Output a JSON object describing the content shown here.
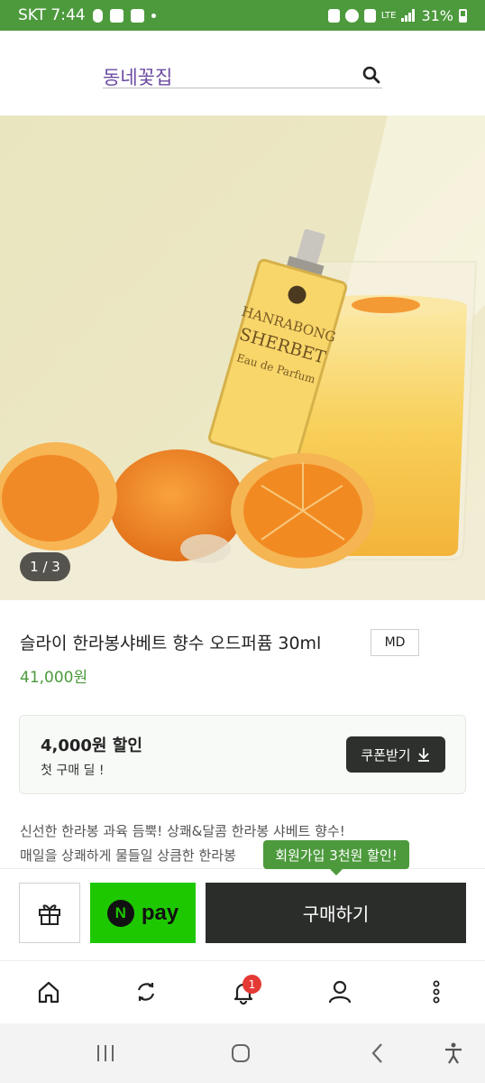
{
  "status_bar": {
    "carrier_time": "SKT 7:44",
    "network": "LTE",
    "battery": "31%"
  },
  "header": {
    "search_text": "동네꽃집",
    "search_icon": "search-icon"
  },
  "product_image": {
    "counter": "1 / 3",
    "bottle_text_1": "HANRABONG",
    "bottle_text_2": "SHERBET",
    "bottle_text_3": "Eau de Parfum"
  },
  "product": {
    "title": "슬라이 한라봉샤베트 향수 오드퍼퓸 30ml",
    "badge": "MD",
    "price": "41,000원",
    "price_color": "#4d9a3d"
  },
  "coupon": {
    "amount": "4,000원 할인",
    "description": "첫 구매 딜 !",
    "button_label": "쿠폰받기"
  },
  "description": {
    "line1": "신선한 한라봉 과육 듬뿍! 상쾌&달콤 한라봉 샤베트 향수!",
    "line2": "매일을 상쾌하게 물들일 상큼한 한라봉"
  },
  "purchase_bar": {
    "signup_tooltip": "회원가입 3천원 할인!",
    "npay_n": "N",
    "npay_label": "pay",
    "buy_label": "구매하기"
  },
  "bottom_nav": {
    "items": [
      "home-icon",
      "refresh-icon",
      "bell-icon",
      "user-icon",
      "more-icon"
    ],
    "notification_count": "1"
  },
  "colors": {
    "brand_green": "#4d9a3d",
    "npay_green": "#1ec800",
    "dark_button": "#2b2d2b"
  }
}
